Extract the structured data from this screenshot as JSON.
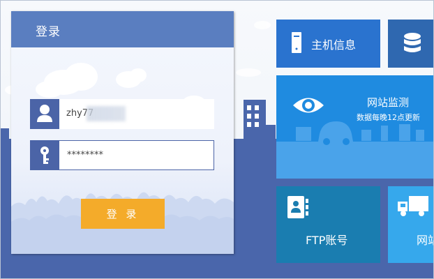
{
  "login": {
    "title": "登录",
    "username_value": "zhy77",
    "password_value": "********",
    "submit_label": "登 录"
  },
  "tiles": {
    "host_info": "主机信息",
    "site_monitor": "网站监测",
    "site_monitor_sub": "数据每晚12点更新",
    "ftp_account": "FTP账号",
    "network": "网站"
  },
  "icons": {
    "user": "user-icon",
    "password": "key-icon",
    "host": "server-icon",
    "database": "database-icon",
    "monitor": "eye-icon",
    "ftp": "contact-book-icon",
    "network": "truck-icon"
  },
  "colors": {
    "header_blue": "#5a7ec0",
    "field_icon_blue": "#4b64a7",
    "login_button": "#f4ab2a",
    "ground_blue": "#4a66ab",
    "tile_host": "#2a73cf",
    "tile_database": "#2f68b0",
    "tile_monitor": "#1f8be0",
    "tile_ftp": "#1a7db0",
    "tile_network": "#36a8ec"
  }
}
